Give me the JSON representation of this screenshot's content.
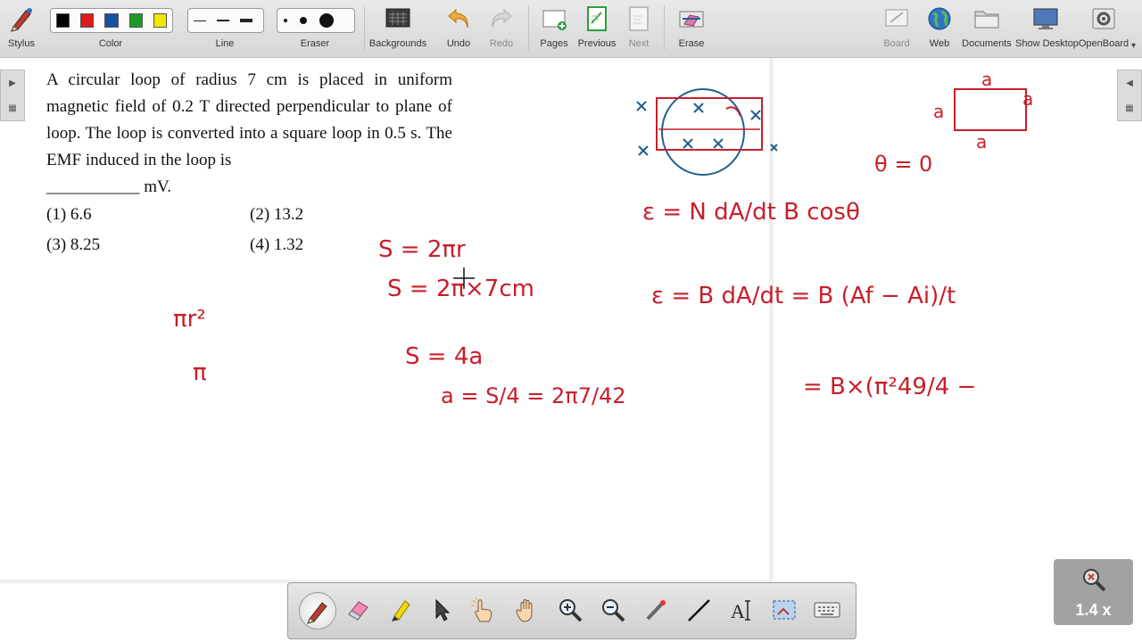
{
  "toolbar": {
    "stylus": "Stylus",
    "color": "Color",
    "line": "Line",
    "eraser": "Eraser",
    "backgrounds": "Backgrounds",
    "undo": "Undo",
    "redo": "Redo",
    "pages": "Pages",
    "previous": "Previous",
    "next": "Next",
    "erase": "Erase",
    "board": "Board",
    "web": "Web",
    "documents": "Documents",
    "show_desktop": "Show Desktop",
    "openboard": "OpenBoard",
    "colors": [
      "#000000",
      "#e01b1b",
      "#1a4fa0",
      "#1d9a2a",
      "#f3e600"
    ]
  },
  "question": {
    "text": "A circular loop of radius 7 cm is placed in uniform magnetic field of 0.2 T directed perpendicular to plane of loop. The loop is converted into a square loop in 0.5 s. The EMF induced in the loop is",
    "blank_line": "___________ mV.",
    "options": [
      "(1) 6.6",
      "(2) 13.2",
      "(3) 8.25",
      "(4) 1.32"
    ]
  },
  "ink": {
    "color": "#c81e2a",
    "blue": "#1f5f8f",
    "lines": [
      "S = 2πr",
      "S = 2π×7cm",
      "S = 4a",
      "a = S/4 = 2π7/42",
      "πr²",
      "π",
      "θ = 0",
      "ε = N dA/dt B cosθ",
      "ε = B dA/dt = B (Af − Ai)/t",
      "= B×(π²49/4 −"
    ],
    "square_labels": [
      "a",
      "a",
      "a",
      "a"
    ]
  },
  "zoom": {
    "level": "1.4 x"
  }
}
